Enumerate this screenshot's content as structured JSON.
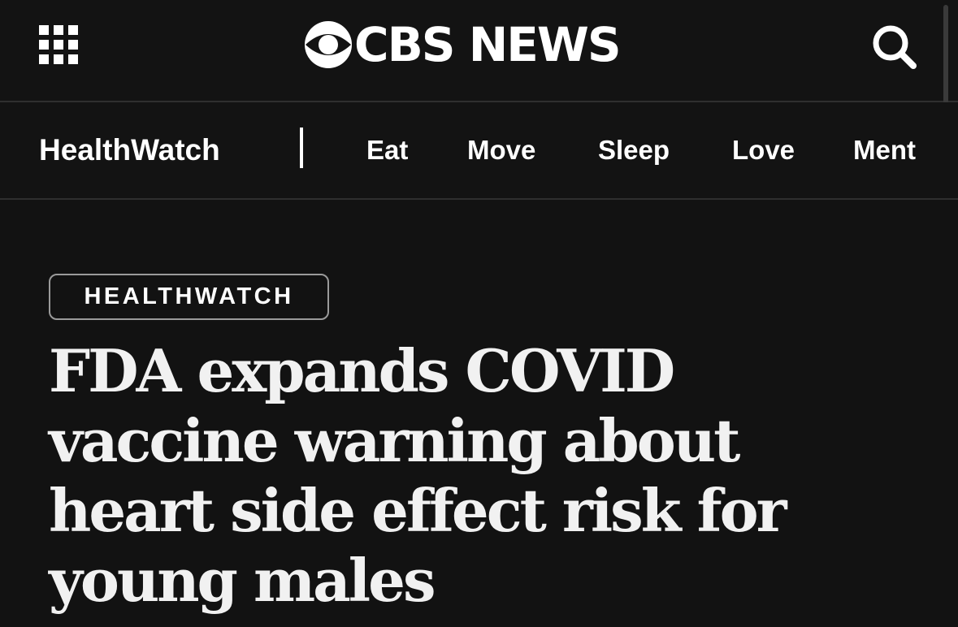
{
  "header": {
    "logo_text": "CBS NEWS",
    "apps_icon": "grid-icon",
    "search_icon": "search-icon"
  },
  "subnav": {
    "title": "HealthWatch",
    "links": [
      "Eat",
      "Move",
      "Sleep",
      "Love",
      "Ment"
    ]
  },
  "article": {
    "section_tag": "HEALTHWATCH",
    "headline": "FDA expands COVID vaccine warning about heart side effect risk for young males"
  },
  "colors": {
    "background": "#121212",
    "text": "#ffffff",
    "divider": "#2f2f2f",
    "tag_border": "#9a9a9a"
  }
}
